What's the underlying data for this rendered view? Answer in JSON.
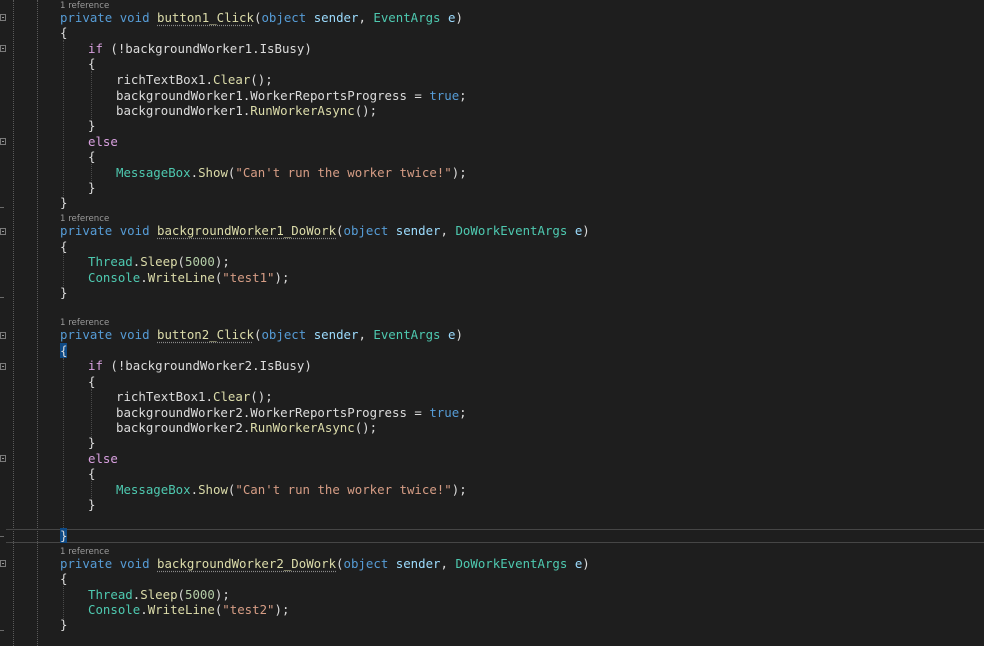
{
  "codelens_label": "1 reference",
  "lines": {
    "l1": {
      "a": "private",
      "b": " ",
      "c": "void",
      "d": " ",
      "e": "button1_Click",
      "f": "(",
      "g": "object",
      "h": " ",
      "i": "sender",
      "j": ", ",
      "k": "EventArgs",
      "l": " ",
      "m": "e",
      "n": ")"
    },
    "l2": "{",
    "l3": {
      "a": "if",
      "b": " (!backgroundWorker1.IsBusy)"
    },
    "l4": "{",
    "l5": {
      "a": "richTextBox1.",
      "b": "Clear",
      "c": "();"
    },
    "l6": {
      "a": "backgroundWorker1.WorkerReportsProgress = ",
      "b": "true",
      "c": ";"
    },
    "l7": {
      "a": "backgroundWorker1.",
      "b": "RunWorkerAsync",
      "c": "();"
    },
    "l8": "}",
    "l9": "else",
    "l10": "{",
    "l11": {
      "a": "MessageBox",
      "b": ".",
      "c": "Show",
      "d": "(",
      "e": "\"Can't run the worker twice!\"",
      "f": ");"
    },
    "l12": "}",
    "l13": "}",
    "l14": {
      "a": "private",
      "c": "void",
      "e": "backgroundWorker1_DoWork",
      "g": "object",
      "i": "sender",
      "k": "DoWorkEventArgs",
      "m": "e"
    },
    "l15": "{",
    "l16": {
      "a": "Thread",
      "b": ".",
      "c": "Sleep",
      "d": "(",
      "e": "5000",
      "f": ");"
    },
    "l17": {
      "a": "Console",
      "b": ".",
      "c": "WriteLine",
      "d": "(",
      "e": "\"test1\"",
      "f": ");"
    },
    "l18": "}",
    "l19": {
      "a": "private",
      "c": "void",
      "e": "button2_Click",
      "g": "object",
      "i": "sender",
      "k": "EventArgs",
      "m": "e"
    },
    "l20": "{",
    "l21": {
      "a": "if",
      "b": " (!backgroundWorker2.IsBusy)"
    },
    "l22": "{",
    "l23": {
      "a": "richTextBox1.",
      "b": "Clear",
      "c": "();"
    },
    "l24": {
      "a": "backgroundWorker2.WorkerReportsProgress = ",
      "b": "true",
      "c": ";"
    },
    "l25": {
      "a": "backgroundWorker2.",
      "b": "RunWorkerAsync",
      "c": "();"
    },
    "l26": "}",
    "l27": "else",
    "l28": "{",
    "l29": {
      "a": "MessageBox",
      "b": ".",
      "c": "Show",
      "d": "(",
      "e": "\"Can't run the worker twice!\"",
      "f": ");"
    },
    "l30": "}",
    "l31": "}",
    "l32": {
      "a": "private",
      "c": "void",
      "e": "backgroundWorker2_DoWork",
      "g": "object",
      "i": "sender",
      "k": "DoWorkEventArgs",
      "m": "e"
    },
    "l33": "{",
    "l34": {
      "a": "Thread",
      "b": ".",
      "c": "Sleep",
      "d": "(",
      "e": "5000",
      "f": ");"
    },
    "l35": {
      "a": "Console",
      "b": ".",
      "c": "WriteLine",
      "d": "(",
      "e": "\"test2\"",
      "f": ");"
    },
    "l36": "}"
  },
  "colors": {
    "background": "#1e1e1e",
    "keyword": "#569cd6",
    "control_keyword": "#d8a0df",
    "type": "#4ec9b0",
    "method": "#dcdcaa",
    "parameter": "#9cdcfe",
    "string": "#d69d85",
    "number": "#b5cea8",
    "brace_highlight": "#0f4a85"
  }
}
